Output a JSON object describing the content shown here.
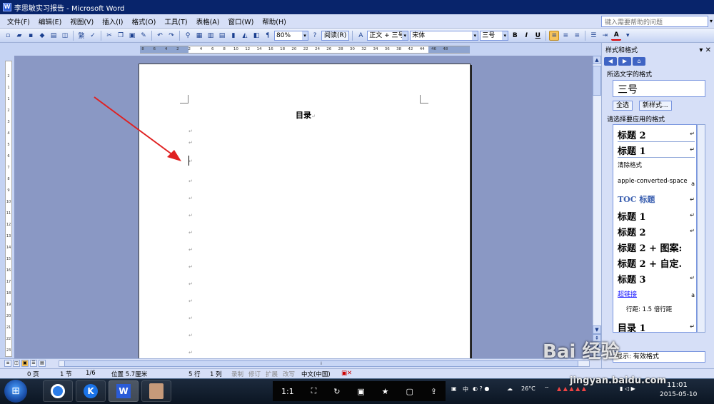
{
  "window": {
    "title": "李思敏实习报告 - Microsoft Word"
  },
  "menu": [
    "文件(F)",
    "编辑(E)",
    "视图(V)",
    "插入(I)",
    "格式(O)",
    "工具(T)",
    "表格(A)",
    "窗口(W)",
    "帮助(H)"
  ],
  "help_box": {
    "placeholder": "键入需要帮助的问题"
  },
  "toolbar": {
    "zoom": "80%",
    "read_label": "阅读(R)",
    "style": "正文 + 三号",
    "font": "宋体",
    "size": "三号",
    "bold": "B",
    "italic": "I",
    "underline": "U",
    "font_color": "A"
  },
  "ruler_ticks": [
    "8",
    "6",
    "4",
    "2",
    "2",
    "4",
    "6",
    "8",
    "10",
    "12",
    "14",
    "16",
    "18",
    "20",
    "22",
    "24",
    "26",
    "28",
    "30",
    "32",
    "34",
    "36",
    "38",
    "42",
    "44",
    "46",
    "48"
  ],
  "vruler_ticks": [
    "2",
    "1",
    "1",
    "2",
    "3",
    "4",
    "5",
    "6",
    "7",
    "8",
    "9",
    "10",
    "11",
    "12",
    "13",
    "14",
    "15",
    "16",
    "17",
    "18",
    "19",
    "20",
    "21",
    "22",
    "23"
  ],
  "document": {
    "heading": "目录",
    "para_mark": "↵"
  },
  "taskpane": {
    "title": "样式和格式",
    "selected_format_label": "所选文字的格式",
    "current_format": "三号",
    "select_all_button": "全选",
    "new_style_button": "新样式...",
    "apply_label": "请选择要应用的格式",
    "styles": [
      {
        "name": "标题 2",
        "mark": "↵"
      },
      {
        "name": "标题 1",
        "mark": "↵"
      },
      {
        "name": "清除格式",
        "mark": ""
      },
      {
        "name": "apple-converted-space",
        "mark": "a"
      },
      {
        "name": "TOC 标题",
        "mark": "↵"
      },
      {
        "name": "标题 1",
        "mark": "↵"
      },
      {
        "name": "标题 2",
        "mark": "↵"
      },
      {
        "name": "标题 2 + 图案:",
        "mark": ""
      },
      {
        "name": "标题 2 + 自定.",
        "mark": ""
      },
      {
        "name": "标题 3",
        "mark": "↵"
      },
      {
        "name": "超链接",
        "mark": "a"
      },
      {
        "name": "行距: 1.5 倍行距",
        "mark": ""
      },
      {
        "name": "目录 1",
        "mark": "↵"
      }
    ],
    "show_label": "显示",
    "show_value": "有效格式"
  },
  "statusbar": {
    "page": "0 页",
    "section": "1 节",
    "page_of": "1/6",
    "position": "位置 5.7厘米",
    "line": "5 行",
    "column": "1 列",
    "rec": "录制",
    "trk": "修订",
    "ext": "扩展",
    "ovr": "改写",
    "lang": "中文(中国)"
  },
  "taskbar": {
    "ratio": "1:1",
    "ime": "中",
    "temperature": "26°C",
    "time": "11:01",
    "date": "2015-05-10"
  },
  "watermark": {
    "brand": "Bai 经验",
    "url": "jingyan.baidu.com"
  }
}
